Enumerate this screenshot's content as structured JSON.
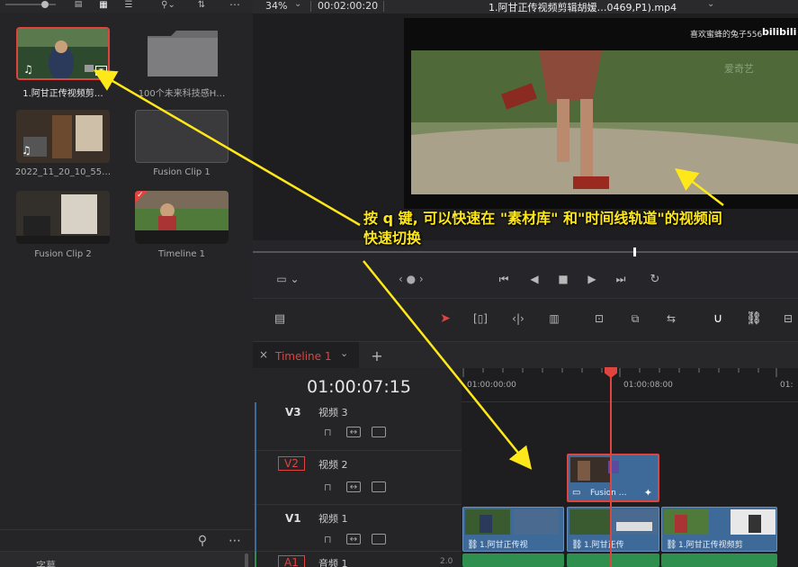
{
  "media_pool": {
    "clips": [
      {
        "label": "1.阿甘正传视频剪…"
      },
      {
        "label": "100个未来科技感H…"
      },
      {
        "label": "2022_11_20_10_55…"
      },
      {
        "label": "Fusion Clip 1"
      },
      {
        "label": "Fusion Clip 2"
      },
      {
        "label": "Timeline 1"
      }
    ],
    "bottom_label": "字幕"
  },
  "viewer": {
    "zoom": "34%",
    "timecode": "00:02:00:20",
    "title": "1.阿甘正传视频剪辑胡嫒…0469,P1).mp4",
    "watermark_user": "喜欢蜜蜂的兔子556",
    "watermark_brand": "bilibili",
    "video_logo": "爱奇艺"
  },
  "transport": {
    "nav_label": "‹ ● ›"
  },
  "timeline": {
    "tab_label": "Timeline 1",
    "timecode": "01:00:07:15",
    "ruler": [
      "01:00:00:00",
      "01:00:08:00",
      "01:"
    ],
    "tracks": [
      {
        "id": "V3",
        "name": "视频 3"
      },
      {
        "id": "V2",
        "name": "视频 2"
      },
      {
        "id": "V1",
        "name": "视频 1"
      },
      {
        "id": "A1",
        "name": "音频 1",
        "level": "2.0"
      }
    ],
    "clips": {
      "v2_fusion": "Fusion …",
      "v1_a": "1.阿甘正传视",
      "v1_b": "1.阿甘正传",
      "v1_c": "1.阿甘正传视频剪"
    }
  },
  "annotation": {
    "line1": "按 q 键, 可以快速在 \"素材库\" 和\"时间线轨道\"的视频间",
    "line2": "快速切换"
  },
  "colors": {
    "accent": "#e0443e",
    "arrow": "#ffe81a",
    "clip": "#3e6a9a",
    "audio": "#2f8f4e"
  }
}
